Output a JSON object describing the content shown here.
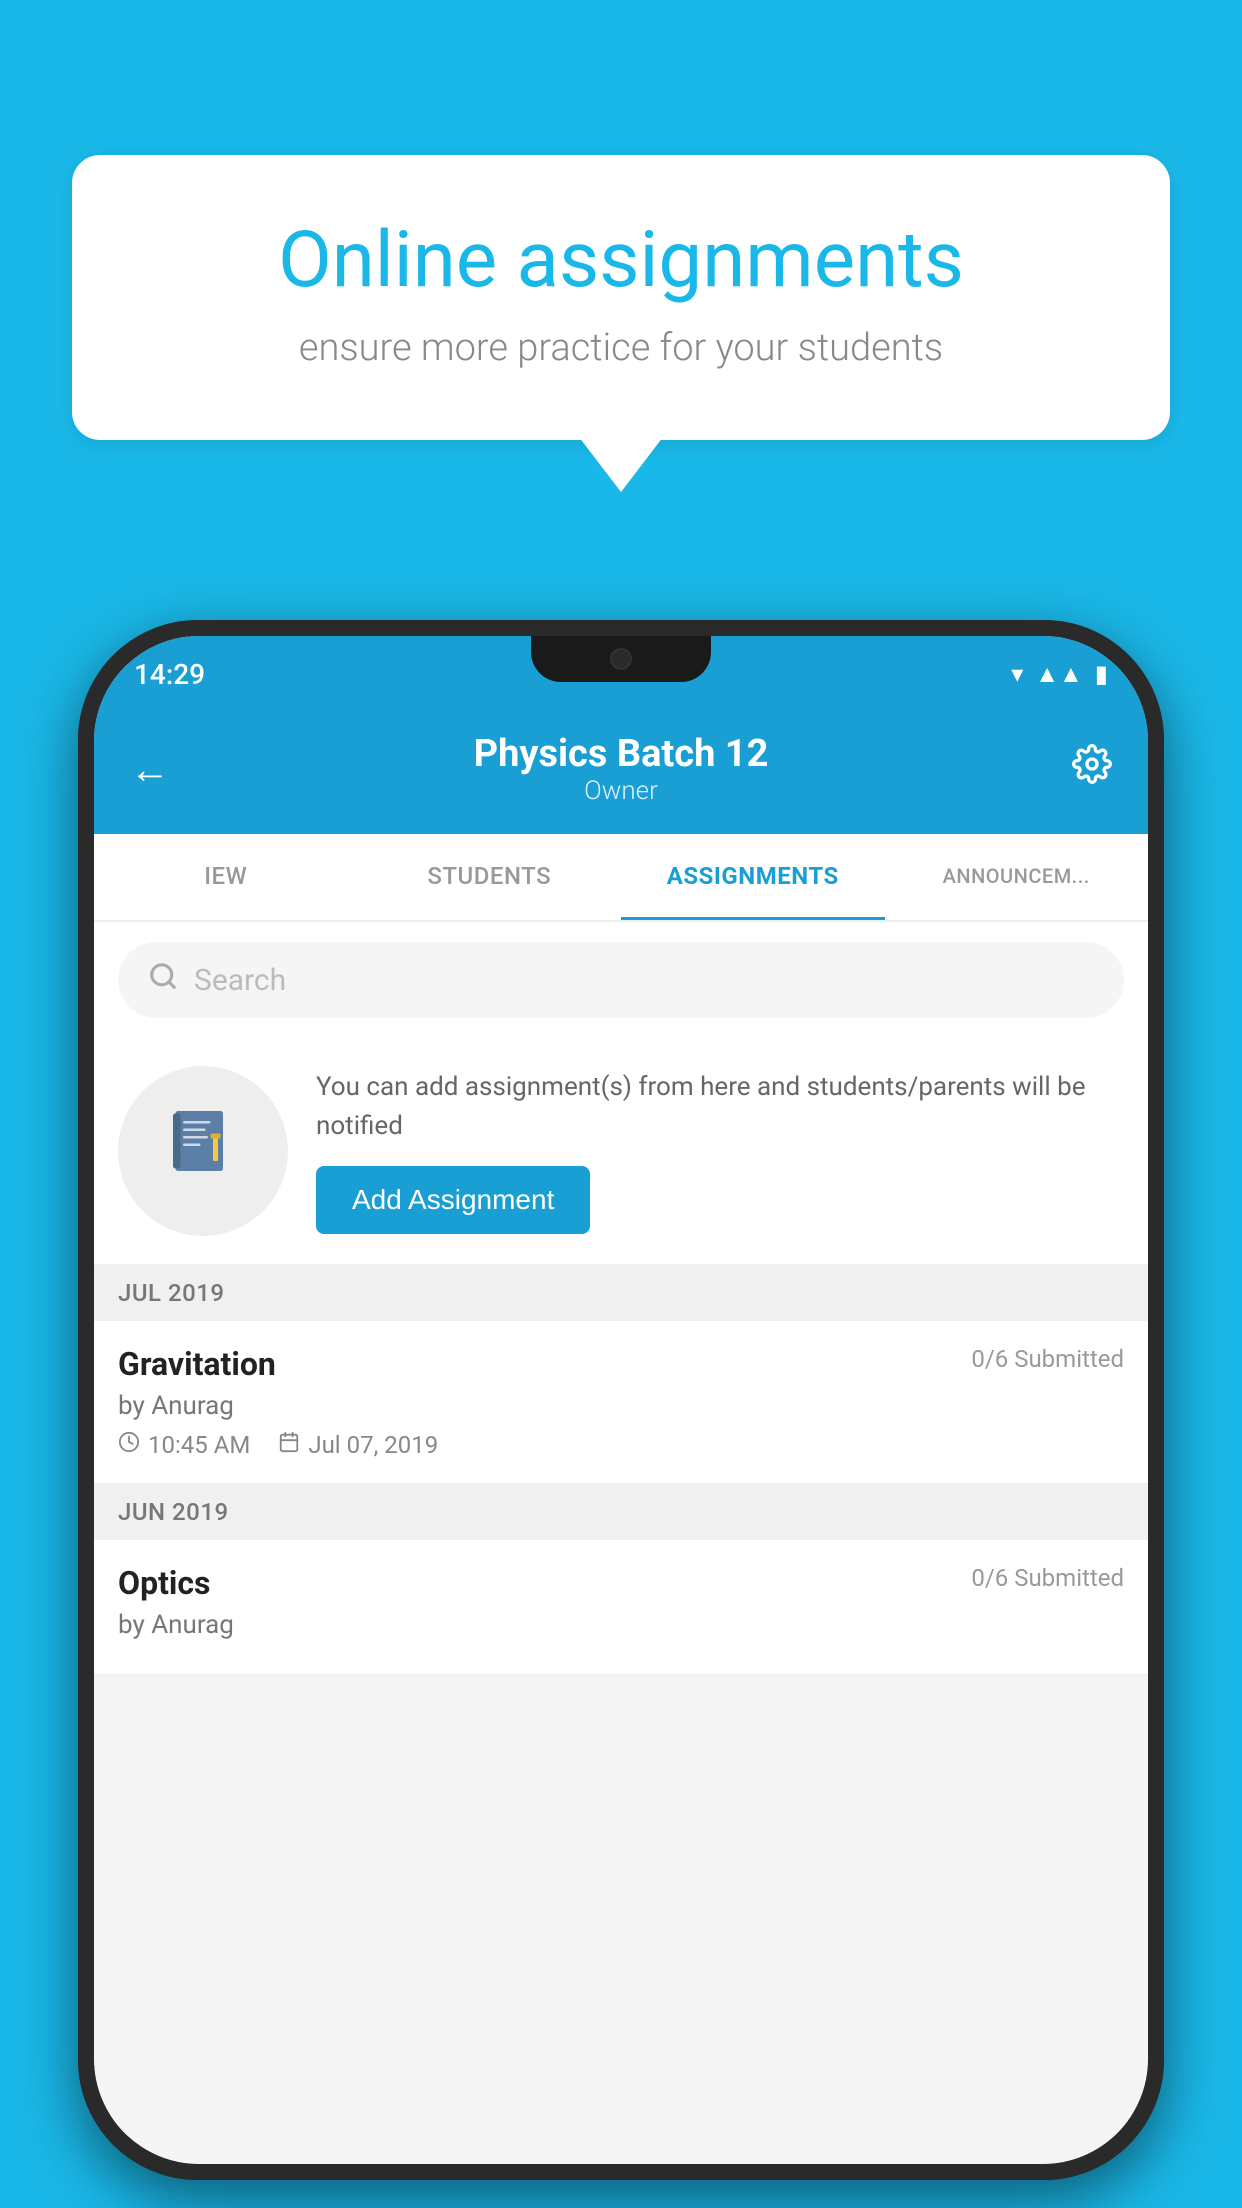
{
  "background_color": "#1ab8e8",
  "speech_bubble": {
    "title": "Online assignments",
    "subtitle": "ensure more practice for your students"
  },
  "phone": {
    "status_bar": {
      "time": "14:29"
    },
    "header": {
      "title": "Physics Batch 12",
      "subtitle": "Owner",
      "back_label": "←",
      "settings_label": "⚙"
    },
    "tabs": [
      {
        "label": "IEW",
        "active": false
      },
      {
        "label": "STUDENTS",
        "active": false
      },
      {
        "label": "ASSIGNMENTS",
        "active": true
      },
      {
        "label": "ANNOUNCEM...",
        "active": false
      }
    ],
    "search": {
      "placeholder": "Search"
    },
    "promo": {
      "text": "You can add assignment(s) from here and students/parents will be notified",
      "button_label": "Add Assignment"
    },
    "sections": [
      {
        "label": "JUL 2019",
        "assignments": [
          {
            "title": "Gravitation",
            "submitted": "0/6 Submitted",
            "author": "by Anurag",
            "time": "10:45 AM",
            "date": "Jul 07, 2019"
          }
        ]
      },
      {
        "label": "JUN 2019",
        "assignments": [
          {
            "title": "Optics",
            "submitted": "0/6 Submitted",
            "author": "by Anurag",
            "time": "",
            "date": ""
          }
        ]
      }
    ]
  }
}
